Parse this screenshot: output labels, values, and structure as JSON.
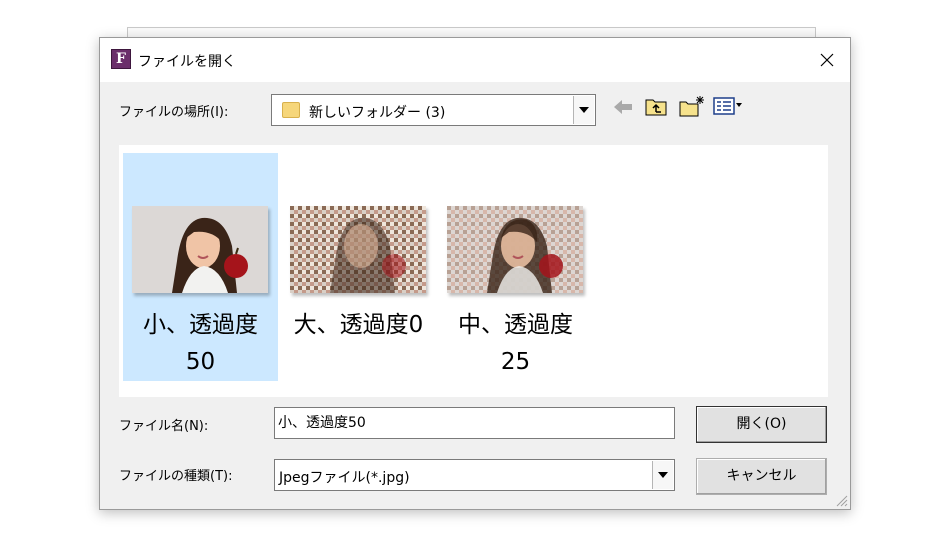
{
  "dialog": {
    "title": "ファイルを開く",
    "app_icon_letter": "F"
  },
  "location": {
    "label": "ファイルの場所(I):",
    "value": "新しいフォルダー (3)"
  },
  "toolbar": {
    "icons": [
      "back-arrow-icon",
      "up-folder-icon",
      "new-folder-icon",
      "view-menu-icon"
    ]
  },
  "files": [
    {
      "line1": "小、透過度",
      "line2": "50",
      "selected": true
    },
    {
      "line1": "大、透過度0",
      "line2": "",
      "selected": false
    },
    {
      "line1": "中、透過度",
      "line2": "25",
      "selected": false
    }
  ],
  "filename": {
    "label": "ファイル名(N):",
    "value": "小、透過度50"
  },
  "filetype": {
    "label": "ファイルの種類(T):",
    "value": "Jpegファイル(*.jpg)"
  },
  "buttons": {
    "open": "開く(O)",
    "cancel": "キャンセル"
  },
  "colors": {
    "selection": "#cce8ff",
    "app_icon": "#6b2f6b"
  }
}
